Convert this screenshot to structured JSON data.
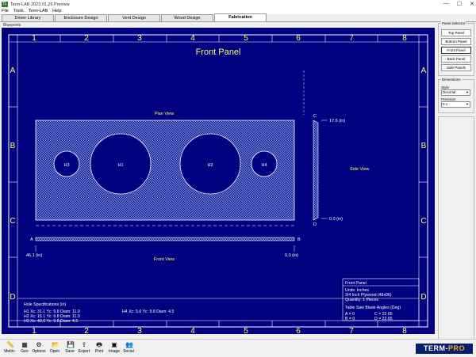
{
  "window": {
    "title": "Term-LAB 2023.01.26 Preview",
    "icon_text": "TL",
    "controls": [
      "—",
      "☐",
      "✕"
    ]
  },
  "menu": [
    "File",
    "Tools",
    "Term-LAB",
    "Help"
  ],
  "tabs": [
    {
      "label": "Driver Library",
      "active": false
    },
    {
      "label": "Enclosure Design",
      "active": false
    },
    {
      "label": "Vent Design",
      "active": false
    },
    {
      "label": "Wood Design",
      "active": false
    },
    {
      "label": "Fabrication",
      "active": true
    }
  ],
  "blueprint": {
    "group_label": "Blueprints",
    "title": "Front Panel",
    "col_labels": [
      "1",
      "2",
      "3",
      "4",
      "5",
      "6",
      "7",
      "8"
    ],
    "row_labels": [
      "A",
      "B",
      "C",
      "D"
    ],
    "plan_view_label": "Plan View",
    "front_view_label": "Front View",
    "side_view_label": "Side View",
    "holes": [
      {
        "name": "H3",
        "x": 40.6,
        "y": 9.8,
        "diam": 4.5
      },
      {
        "name": "H1",
        "x": 31.1,
        "y": 9.8,
        "diam": 11.0
      },
      {
        "name": "H2",
        "x": 15.1,
        "y": 9.8,
        "diam": 11.0
      },
      {
        "name": "H4",
        "x": 5.6,
        "y": 9.8,
        "diam": 4.5
      }
    ],
    "front_view": {
      "a_label": "A",
      "b_label": "B",
      "left_dim": "46.1 (in)",
      "right_dim": "0.0 (in)"
    },
    "side_view": {
      "c_label": "C",
      "d_label": "D",
      "top_dim": "17.6 (in)",
      "bottom_dim": "0.0 (in)"
    },
    "info": {
      "title": "Front Panel",
      "units": "Units: Inches",
      "material": "3/4 Inch Plywood (48x96)",
      "quantity": "Quantity: 1 Pieces",
      "angles_title": "Table Saw Blade Angles (Deg)",
      "a": "A = 0",
      "b": "B = 0",
      "c": "C = 22.65",
      "d": "D = 22.65"
    },
    "hole_specs": {
      "title": "Hole Specifications (in)",
      "h1": "H1 Xc: 31.1 Yc: 9.8 Diam: 11.0",
      "h2": "H2 Xc: 15.1 Yc: 9.8 Diam: 11.0",
      "h3": "H3 Xc: 40.6 Yc: 9.8 Diam: 4.5",
      "h4": "H4 Xc: 5.6 Yc: 9.8 Diam: 4.5"
    }
  },
  "panel_selector": {
    "label": "Panel Selector",
    "buttons": [
      {
        "label": "Top Panel",
        "selected": false
      },
      {
        "label": "Bottom Panel",
        "selected": false
      },
      {
        "label": "Front Panel",
        "selected": true
      },
      {
        "label": "Back Panel",
        "selected": false
      },
      {
        "label": "Side Panels",
        "selected": false
      }
    ]
  },
  "dimensions": {
    "label": "Dimensions",
    "style_label": "Style",
    "style_value": "Decimal",
    "precision_label": "Precision",
    "precision_value": "0.1"
  },
  "toolbar": [
    {
      "label": "Metric",
      "icon": "📏"
    },
    {
      "label": "Geo",
      "icon": "▦"
    },
    {
      "label": "Options",
      "icon": "⚙"
    },
    {
      "label": "Open",
      "icon": "📂"
    },
    {
      "label": "Save",
      "icon": "💾"
    },
    {
      "label": "Export",
      "icon": "⇪"
    },
    {
      "label": "Print",
      "icon": "🖶"
    },
    {
      "label": "Image",
      "icon": "▣"
    },
    {
      "label": "Social",
      "icon": "👥"
    }
  ],
  "logo": {
    "left": "TERM-",
    "right": "PRO"
  },
  "colors": {
    "blueprint_bg": "#000080",
    "line": "#ffffff",
    "accent_text": "#ffff66"
  }
}
